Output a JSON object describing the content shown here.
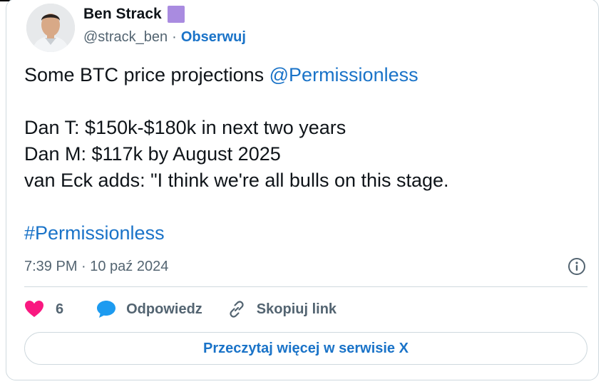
{
  "author": {
    "display_name": "Ben Strack",
    "handle": "@strack_ben",
    "separator": "·",
    "follow_label": "Obserwuj",
    "badge_color": "#a98be0"
  },
  "tweet": {
    "intro": "Some BTC price projections ",
    "mention": "@Permissionless",
    "line1": "Dan T: $150k-$180k in next two years",
    "line2": "Dan M: $117k by August 2025",
    "line3": "van Eck adds: \"I think we're all bulls on this stage.",
    "hashtag": "#Permissionless"
  },
  "meta": {
    "timestamp": "7:39 PM · 10 paź 2024",
    "info_icon": "info-icon"
  },
  "actions": {
    "like_count": "6",
    "reply_label": "Odpowiedz",
    "copy_link_label": "Skopiuj link",
    "like_icon": "heart-icon",
    "reply_icon": "speech-bubble-icon",
    "copy_icon": "link-icon"
  },
  "read_more_label": "Przeczytaj więcej w serwisie X",
  "colors": {
    "accent": "#1a73c8",
    "like": "#f91880",
    "reply": "#1d9bf0",
    "muted": "#536471"
  }
}
